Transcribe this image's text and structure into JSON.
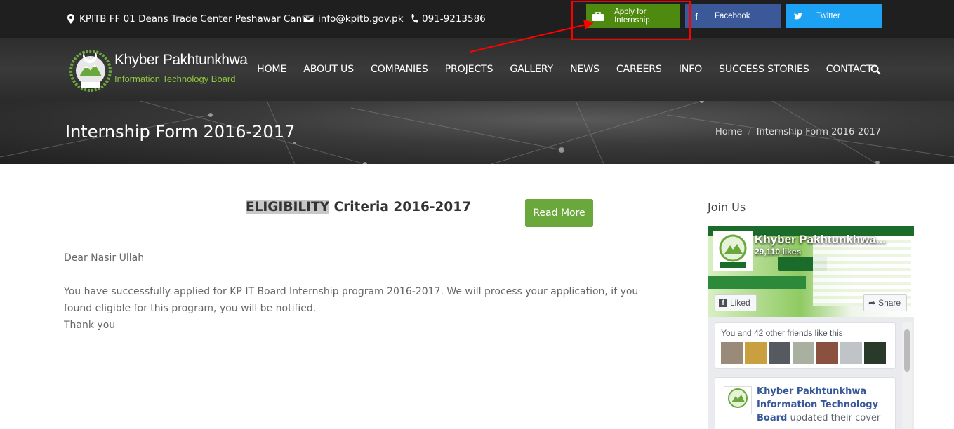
{
  "topbar": {
    "address": "KPITB FF 01 Deans Trade Center Peshawar Cantt.",
    "email": "info@kpitb.gov.pk",
    "phone": "091-9213586",
    "apply_label": "Apply for Internship",
    "facebook_label": "Facebook",
    "twitter_label": "Twitter"
  },
  "logo": {
    "line1": "Khyber Pakhtunkhwa",
    "line2": "Information Technology Board"
  },
  "nav": {
    "items": [
      "HOME",
      "ABOUT US",
      "COMPANIES",
      "PROJECTS",
      "GALLERY",
      "NEWS",
      "CAREERS",
      "INFO",
      "SUCCESS STORIES",
      "CONTACT"
    ]
  },
  "hero": {
    "title": "Internship Form 2016-2017",
    "breadcrumb_home": "Home",
    "breadcrumb_sep": "/",
    "breadcrumb_current": "Internship Form 2016-2017"
  },
  "main": {
    "heading_highlight": "ELIGIBILITY",
    "heading_rest": " Criteria 2016-2017",
    "read_more": "Read More",
    "greeting": "Dear  Nasir Ullah",
    "message": "You have successfully applied for KP IT Board Internship program 2016-2017. We will process your application, if you found eligible for this program, you will be notified.",
    "thanks": "Thank you"
  },
  "sidebar": {
    "join_title": "Join Us",
    "fb_page_name": "Khyber Pakhtunkhwa...",
    "fb_likes": "29,110 likes",
    "liked_label": "Liked",
    "share_label": "Share",
    "friends_text": "You and 42 other friends like this",
    "post_author": "Khyber Pakhtunkhwa Information Technology Board",
    "post_text": " updated their cover"
  },
  "colors": {
    "topbar_bg": "#1f1f1f",
    "apply_bg": "#4f8a10",
    "facebook_bg": "#3b5998",
    "twitter_bg": "#1da1f2",
    "read_more_bg": "#6aa83c",
    "annotation_red": "#ff0000"
  }
}
